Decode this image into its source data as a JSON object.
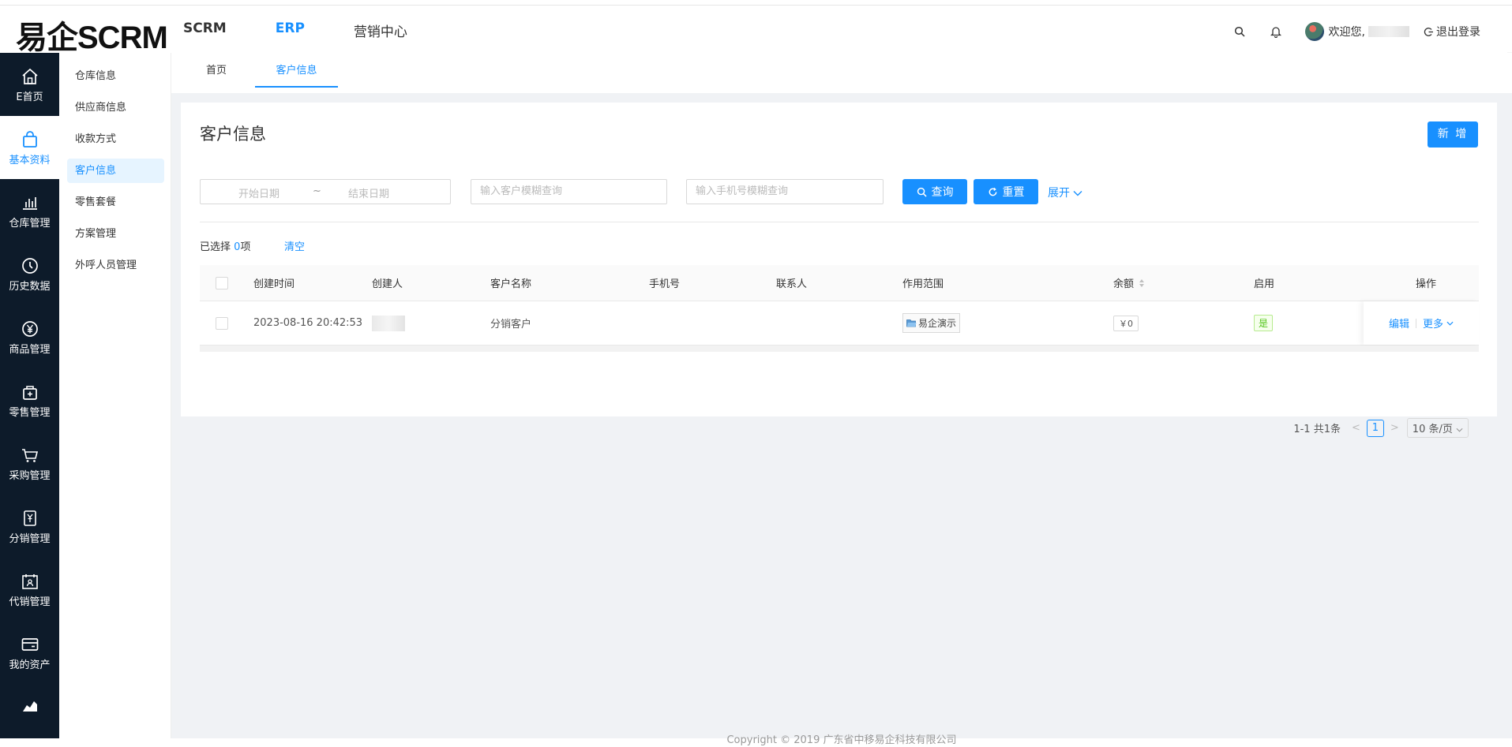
{
  "header": {
    "logo": "易企SCRM",
    "nav": [
      "SCRM",
      "ERP",
      "营销中心"
    ],
    "welcome": "欢迎您,",
    "logout": "退出登录"
  },
  "sidebar": [
    {
      "label": "E首页",
      "icon": "home-icon"
    },
    {
      "label": "基本资料",
      "icon": "bag-icon"
    },
    {
      "label": "仓库管理",
      "icon": "bar-chart-icon"
    },
    {
      "label": "历史数据",
      "icon": "clock-icon"
    },
    {
      "label": "商品管理",
      "icon": "yen-icon"
    },
    {
      "label": "零售管理",
      "icon": "retail-icon"
    },
    {
      "label": "采购管理",
      "icon": "cart-icon"
    },
    {
      "label": "分销管理",
      "icon": "distribution-icon"
    },
    {
      "label": "代销管理",
      "icon": "consign-icon"
    },
    {
      "label": "我的资产",
      "icon": "wallet-icon"
    }
  ],
  "submenu": [
    "仓库信息",
    "供应商信息",
    "收款方式",
    "客户信息",
    "零售套餐",
    "方案管理",
    "外呼人员管理"
  ],
  "tabs": [
    "首页",
    "客户信息"
  ],
  "page": {
    "title": "客户信息",
    "new_button": "新 增",
    "filters": {
      "start_date": "开始日期",
      "tilde": "~",
      "end_date": "结束日期",
      "customer_placeholder": "输入客户模糊查询",
      "phone_placeholder": "输入手机号模糊查询",
      "query": "查询",
      "reset": "重置",
      "expand": "展开"
    },
    "selected_prefix": "已选择",
    "selected_count": "0",
    "selected_suffix": "项",
    "clear": "清空"
  },
  "table": {
    "columns": [
      "创建时间",
      "创建人",
      "客户名称",
      "手机号",
      "联系人",
      "作用范围",
      "余额",
      "启用",
      "操作"
    ],
    "rows": [
      {
        "created_at": "2023-08-16 20:42:53",
        "customer_name": "分销客户",
        "phone": "",
        "contact": "",
        "scope": "易企演示",
        "balance": "￥0",
        "enabled": "是",
        "edit": "编辑",
        "more": "更多"
      }
    ]
  },
  "pagination": {
    "summary": "1-1 共1条",
    "current_page": "1",
    "page_size": "10 条/页"
  },
  "footer": "Copyright © 2019 广东省中移易企科技有限公司",
  "colors": {
    "primary": "#1890ff",
    "sidebar_bg": "#0d1b2a",
    "success": "#52c41a"
  }
}
